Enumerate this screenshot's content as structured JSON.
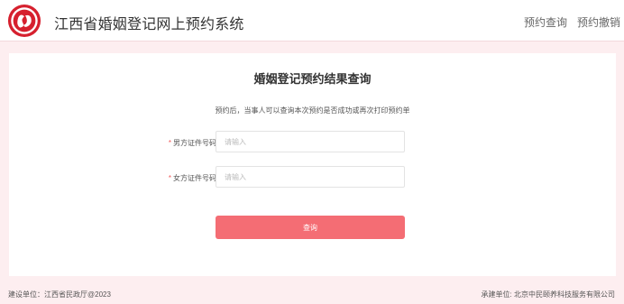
{
  "header": {
    "title": "江西省婚姻登记网上预约系统",
    "nav": [
      {
        "label": "预约查询"
      },
      {
        "label": "预约撤销"
      }
    ],
    "logo": "wedding-logo-icon",
    "brand_color": "#d6202e"
  },
  "form": {
    "title": "婚姻登记预约结果查询",
    "subtitle": "预约后，当事人可以查询本次预约是否成功或再次打印预约单",
    "required_mark": "*",
    "fields": [
      {
        "label": "男方证件号码",
        "placeholder": "请输入",
        "value": ""
      },
      {
        "label": "女方证件号码",
        "placeholder": "请输入",
        "value": ""
      }
    ],
    "submit_label": "查询",
    "accent_color": "#f46d74"
  },
  "footer": {
    "left": "建设单位：江西省民政厅@2023",
    "right": "承建单位: 北京中民颐养科技服务有限公司"
  }
}
